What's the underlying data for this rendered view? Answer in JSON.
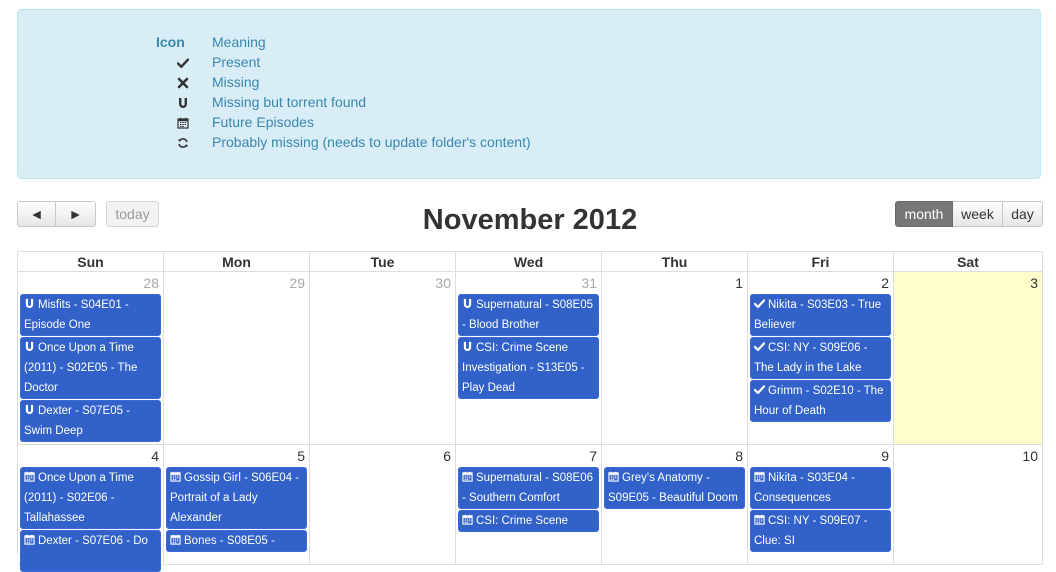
{
  "legend": {
    "header": {
      "icon": "Icon",
      "text": "Meaning"
    },
    "rows": [
      {
        "icon": "check-icon",
        "text": "Present"
      },
      {
        "icon": "cross-icon",
        "text": "Missing"
      },
      {
        "icon": "magnet-icon",
        "text": "Missing but torrent found"
      },
      {
        "icon": "calendar-icon",
        "text": "Future Episodes"
      },
      {
        "icon": "refresh-icon",
        "text": "Probably missing (needs to update folder's content)"
      }
    ]
  },
  "toolbar": {
    "prev": "◄",
    "next": "►",
    "today": "today",
    "title": "November 2012",
    "views": [
      "month",
      "week",
      "day"
    ],
    "active_view": "month"
  },
  "calendar": {
    "weekdays": [
      "Sun",
      "Mon",
      "Tue",
      "Wed",
      "Thu",
      "Fri",
      "Sat"
    ],
    "weeks": [
      [
        {
          "day": "28",
          "other": true,
          "events": [
            {
              "icon": "magnet-icon",
              "text": "Misfits - S04E01 - Episode One"
            },
            {
              "icon": "magnet-icon",
              "text": "Once Upon a Time (2011) - S02E05 - The Doctor"
            },
            {
              "icon": "magnet-icon",
              "text": "Dexter - S07E05 - Swim Deep"
            }
          ]
        },
        {
          "day": "29",
          "other": true,
          "events": []
        },
        {
          "day": "30",
          "other": true,
          "events": []
        },
        {
          "day": "31",
          "other": true,
          "events": [
            {
              "icon": "magnet-icon",
              "text": "Supernatural - S08E05 - Blood Brother"
            },
            {
              "icon": "magnet-icon",
              "text": "CSI: Crime Scene Investigation - S13E05 - Play Dead"
            }
          ]
        },
        {
          "day": "1",
          "other": false,
          "events": []
        },
        {
          "day": "2",
          "other": false,
          "events": [
            {
              "icon": "check-icon",
              "text": "Nikita - S03E03 - True Believer"
            },
            {
              "icon": "check-icon",
              "text": "CSI: NY - S09E06 - The Lady in the Lake"
            },
            {
              "icon": "check-icon",
              "text": "Grimm - S02E10 - The Hour of Death"
            }
          ]
        },
        {
          "day": "3",
          "other": false,
          "today": true,
          "events": []
        }
      ],
      [
        {
          "day": "4",
          "other": false,
          "events": [
            {
              "icon": "calendar-icon",
              "text": "Once Upon a Time (2011) - S02E06 - Tallahassee"
            },
            {
              "icon": "calendar-icon",
              "text": "Dexter - S07E06 - Do"
            }
          ]
        },
        {
          "day": "5",
          "other": false,
          "events": [
            {
              "icon": "calendar-icon",
              "text": "Gossip Girl - S06E04 - Portrait of a Lady Alexander"
            },
            {
              "icon": "calendar-icon",
              "text": "Bones - S08E05 -"
            }
          ]
        },
        {
          "day": "6",
          "other": false,
          "events": []
        },
        {
          "day": "7",
          "other": false,
          "events": [
            {
              "icon": "calendar-icon",
              "text": "Supernatural - S08E06 - Southern Comfort"
            },
            {
              "icon": "calendar-icon",
              "text": "CSI: Crime Scene"
            }
          ]
        },
        {
          "day": "8",
          "other": false,
          "events": [
            {
              "icon": "calendar-icon",
              "text": "Grey's Anatomy - S09E05 - Beautiful Doom"
            }
          ]
        },
        {
          "day": "9",
          "other": false,
          "events": [
            {
              "icon": "calendar-icon",
              "text": "Nikita - S03E04 - Consequences"
            },
            {
              "icon": "calendar-icon",
              "text": "CSI: NY - S09E07 - Clue: SI"
            }
          ]
        },
        {
          "day": "10",
          "other": false,
          "events": []
        }
      ]
    ]
  }
}
